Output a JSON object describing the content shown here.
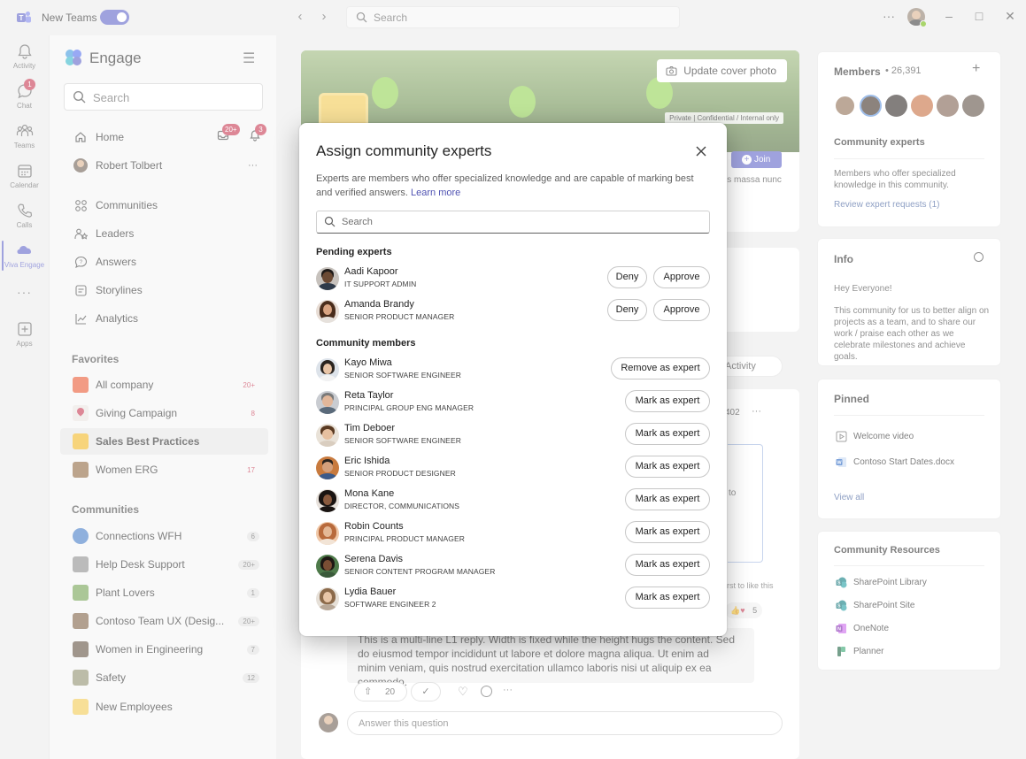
{
  "titlebar": {
    "app_name": "New Teams",
    "search_placeholder": "Search",
    "back_glyph": "‹",
    "forward_glyph": "›",
    "more_glyph": "···",
    "minimize_glyph": "–",
    "maximize_glyph": "□",
    "close_glyph": "✕"
  },
  "rail": {
    "items": [
      {
        "label": "Activity",
        "icon": "bell-icon"
      },
      {
        "label": "Chat",
        "icon": "chat-icon",
        "badge": "1"
      },
      {
        "label": "Teams",
        "icon": "teams-icon"
      },
      {
        "label": "Calendar",
        "icon": "calendar-icon"
      },
      {
        "label": "Calls",
        "icon": "phone-icon"
      },
      {
        "label": "Viva Engage",
        "icon": "engage-icon"
      },
      {
        "label": "",
        "icon": "more-icon"
      },
      {
        "label": "Apps",
        "icon": "apps-icon"
      }
    ],
    "more_glyph": "···"
  },
  "sidebar": {
    "title": "Engage",
    "search_placeholder": "Search",
    "home_label": "Home",
    "inbox_badge": "20+",
    "notif_badge": "3",
    "profile_name": "Robert Tolbert",
    "profile_more": "···",
    "nav": [
      {
        "label": "Communities",
        "icon": "communities-icon"
      },
      {
        "label": "Leaders",
        "icon": "leaders-icon"
      },
      {
        "label": "Answers",
        "icon": "answers-icon"
      },
      {
        "label": "Storylines",
        "icon": "storylines-icon"
      },
      {
        "label": "Analytics",
        "icon": "analytics-icon"
      }
    ],
    "favorites_heading": "Favorites",
    "favorites": [
      {
        "label": "All company",
        "count": "20+",
        "count_style": "red",
        "color": "#e8542c"
      },
      {
        "label": "Giving Campaign",
        "count": "8",
        "count_style": "red",
        "color": "#c4314b"
      },
      {
        "label": "Sales Best Practices",
        "count": "",
        "count_style": "none",
        "color": "#f2b51d"
      },
      {
        "label": "Women ERG",
        "count": "17",
        "count_style": "red",
        "color": "#8c6239"
      }
    ],
    "communities_heading": "Communities",
    "communities": [
      {
        "label": "Connections WFH",
        "count": "6",
        "color": "#3f78c4"
      },
      {
        "label": "Help Desk Support",
        "count": "20+",
        "color": "#8a8a8a"
      },
      {
        "label": "Plant Lovers",
        "count": "1",
        "color": "#6e9f4c"
      },
      {
        "label": "Contoso Team UX (Desig...",
        "count": "20+",
        "color": "#7a5c3e"
      },
      {
        "label": "Women in Engineering",
        "count": "7",
        "color": "#5c4a3a"
      },
      {
        "label": "Safety",
        "count": "12",
        "color": "#8c8c6a"
      },
      {
        "label": "New Employees",
        "count": "",
        "color": "#f2c94c"
      }
    ]
  },
  "main": {
    "update_cover_label": "Update cover photo",
    "privacy_label": "Private | Confidential / Internal only",
    "join_label": "Join",
    "bg_text_1": "is massa nunc",
    "activity_label": "Activity",
    "bg_count": "402",
    "bg_to": "to",
    "bg_like": "irst to like this",
    "reactions_count": "5",
    "reply_text": "This is a multi-line L1 reply. Width is fixed while the height hugs the content. Sed do eiusmod tempor incididunt ut labore et dolore magna aliqua. Ut enim ad minim veniam, quis nostrud exercitation ullamco laboris nisi ut aliquip ex ea commodo.",
    "upvote_count": "20",
    "answer_placeholder": "Answer this question"
  },
  "right_panel": {
    "members_title": "Members",
    "members_count": "• 26,391",
    "add_glyph": "+",
    "experts_title": "Community experts",
    "experts_desc": "Members who offer specialized knowledge in this community.",
    "experts_link": "Review expert requests (1)",
    "info_title": "Info",
    "info_greeting": "Hey Everyone!",
    "info_text": "This community for us to better align on projects as a team, and to share our work / praise each other as we celebrate milestones and achieve goals.",
    "pinned_title": "Pinned",
    "pinned": [
      {
        "label": "Welcome video",
        "icon": "video-icon"
      },
      {
        "label": "Contoso Start Dates.docx",
        "icon": "word-icon"
      }
    ],
    "view_all": "View all",
    "resources_title": "Community Resources",
    "resources": [
      {
        "label": "SharePoint Library",
        "icon": "sharepoint-icon"
      },
      {
        "label": "SharePoint Site",
        "icon": "sharepoint-icon"
      },
      {
        "label": "OneNote",
        "icon": "onenote-icon"
      },
      {
        "label": "Planner",
        "icon": "planner-icon"
      }
    ]
  },
  "dialog": {
    "title": "Assign community experts",
    "description": "Experts are members who offer specialized knowledge and are capable of marking best and verified answers.",
    "learn_more": "Learn more",
    "search_placeholder": "Search",
    "pending_heading": "Pending experts",
    "deny_label": "Deny",
    "approve_label": "Approve",
    "pending": [
      {
        "name": "Aadi Kapoor",
        "title": "IT SUPPORT ADMIN",
        "skin": "#6b4a34",
        "hair": "#1e1a18"
      },
      {
        "name": "Amanda Brandy",
        "title": "SENIOR PRODUCT MANAGER",
        "skin": "#d9a482",
        "hair": "#4a2d1c"
      }
    ],
    "members_heading": "Community members",
    "remove_label": "Remove as expert",
    "mark_label": "Mark as expert",
    "members": [
      {
        "name": "Kayo Miwa",
        "title": "SENIOR SOFTWARE ENGINEER",
        "skin": "#e8c4a6",
        "hair": "#2a2420",
        "is_expert": true
      },
      {
        "name": "Reta Taylor",
        "title": "PRINCIPAL GROUP ENG MANAGER",
        "skin": "#e2b79a",
        "hair": "#7a7a7a",
        "is_expert": false
      },
      {
        "name": "Tim Deboer",
        "title": "SENIOR SOFTWARE ENGINEER",
        "skin": "#e6c0a0",
        "hair": "#5a3a22",
        "is_expert": false
      },
      {
        "name": "Eric Ishida",
        "title": "SENIOR PRODUCT DESIGNER",
        "skin": "#d4a07c",
        "hair": "#2a2420",
        "is_expert": false
      },
      {
        "name": "Mona Kane",
        "title": "DIRECTOR, COMMUNICATIONS",
        "skin": "#8a5a3e",
        "hair": "#1a1412",
        "is_expert": false
      },
      {
        "name": "Robin Counts",
        "title": "PRINCIPAL PRODUCT MANAGER",
        "skin": "#e4b896",
        "hair": "#b86a3c",
        "is_expert": false
      },
      {
        "name": "Serena Davis",
        "title": "SENIOR CONTENT PROGRAM MANAGER",
        "skin": "#7a4e34",
        "hair": "#1e1814",
        "is_expert": false
      },
      {
        "name": "Lydia Bauer",
        "title": "SOFTWARE ENGINEER 2",
        "skin": "#e8c6a8",
        "hair": "#8c6a4a",
        "is_expert": false
      }
    ]
  },
  "colors": {
    "brand": "#5b5fc7",
    "badge_red": "#c4314b",
    "link": "#4f52b2"
  }
}
